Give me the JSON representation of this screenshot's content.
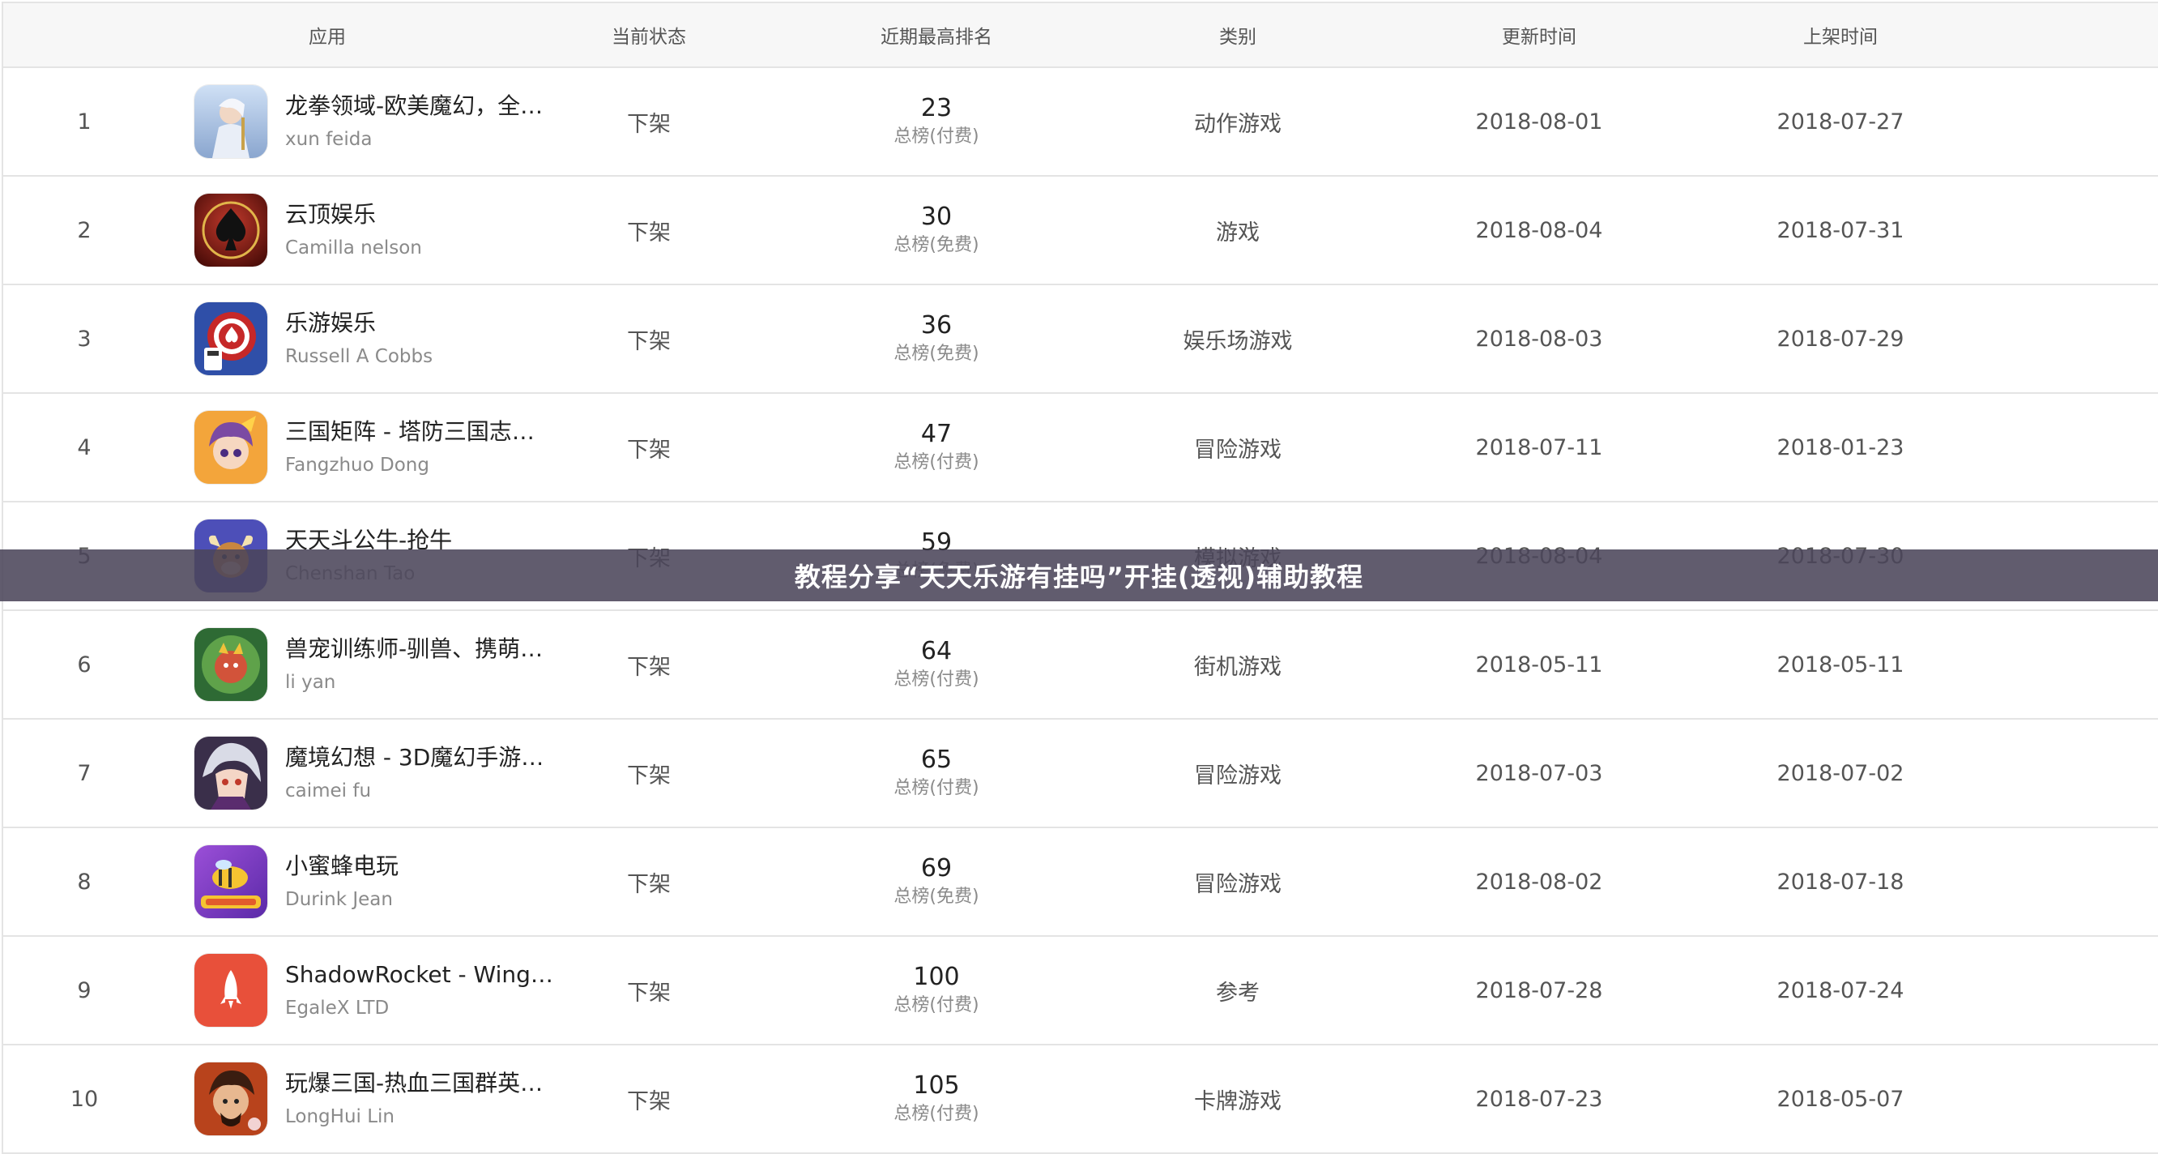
{
  "columns": {
    "app": "应用",
    "status": "当前状态",
    "rank": "近期最高排名",
    "category": "类别",
    "updated": "更新时间",
    "released": "上架时间"
  },
  "rows": [
    {
      "idx": "1",
      "name": "龙拳领域-欧美魔幻，全…",
      "dev": "xun feida",
      "status": "下架",
      "rank": "23",
      "rank_sub": "总榜(付费)",
      "category": "动作游戏",
      "updated": "2018-08-01",
      "released": "2018-07-27",
      "icon": "fantasy-warrior-icon"
    },
    {
      "idx": "2",
      "name": "云顶娱乐",
      "dev": "Camilla nelson",
      "status": "下架",
      "rank": "30",
      "rank_sub": "总榜(免费)",
      "category": "游戏",
      "updated": "2018-08-04",
      "released": "2018-07-31",
      "icon": "spade-icon"
    },
    {
      "idx": "3",
      "name": "乐游娱乐",
      "dev": "Russell A Cobbs",
      "status": "下架",
      "rank": "36",
      "rank_sub": "总榜(免费)",
      "category": "娱乐场游戏",
      "updated": "2018-08-03",
      "released": "2018-07-29",
      "icon": "poker-chip-icon"
    },
    {
      "idx": "4",
      "name": "三国矩阵 - 塔防三国志…",
      "dev": "Fangzhuo Dong",
      "status": "下架",
      "rank": "47",
      "rank_sub": "总榜(付费)",
      "category": "冒险游戏",
      "updated": "2018-07-11",
      "released": "2018-01-23",
      "icon": "anime-hero-icon"
    },
    {
      "idx": "5",
      "name": "天天斗公牛-抢牛",
      "dev": "Chenshan Tao",
      "status": "下架",
      "rank": "59",
      "rank_sub": "总榜(免费)",
      "category": "模拟游戏",
      "updated": "2018-08-04",
      "released": "2018-07-30",
      "icon": "bull-icon"
    },
    {
      "idx": "6",
      "name": "兽宠训练师-驯兽、携萌…",
      "dev": "li yan",
      "status": "下架",
      "rank": "64",
      "rank_sub": "总榜(付费)",
      "category": "街机游戏",
      "updated": "2018-05-11",
      "released": "2018-05-11",
      "icon": "pet-creature-icon"
    },
    {
      "idx": "7",
      "name": "魔境幻想 - 3D魔幻手游…",
      "dev": "caimei fu",
      "status": "下架",
      "rank": "65",
      "rank_sub": "总榜(付费)",
      "category": "冒险游戏",
      "updated": "2018-07-03",
      "released": "2018-07-02",
      "icon": "silver-hair-hero-icon"
    },
    {
      "idx": "8",
      "name": "小蜜蜂电玩",
      "dev": "Durink Jean",
      "status": "下架",
      "rank": "69",
      "rank_sub": "总榜(免费)",
      "category": "冒险游戏",
      "updated": "2018-08-02",
      "released": "2018-07-18",
      "icon": "bee-arcade-icon"
    },
    {
      "idx": "9",
      "name": "ShadowRocket - Wing…",
      "dev": "EgaleX LTD",
      "status": "下架",
      "rank": "100",
      "rank_sub": "总榜(付费)",
      "category": "参考",
      "updated": "2018-07-28",
      "released": "2018-07-24",
      "icon": "rocket-icon"
    },
    {
      "idx": "10",
      "name": "玩爆三国-热血三国群英…",
      "dev": "LongHui Lin",
      "status": "下架",
      "rank": "105",
      "rank_sub": "总榜(付费)",
      "category": "卡牌游戏",
      "updated": "2018-07-23",
      "released": "2018-05-07",
      "icon": "three-kingdoms-warrior-icon"
    }
  ],
  "banner": {
    "text": "教程分享“天天乐游有挂吗”开挂(透视)辅助教程"
  },
  "colors": {
    "header_bg": "#f7f7f7",
    "border": "#e4e4e4",
    "banner_bg": "#4b465a",
    "rocket_red": "#e8503a"
  }
}
